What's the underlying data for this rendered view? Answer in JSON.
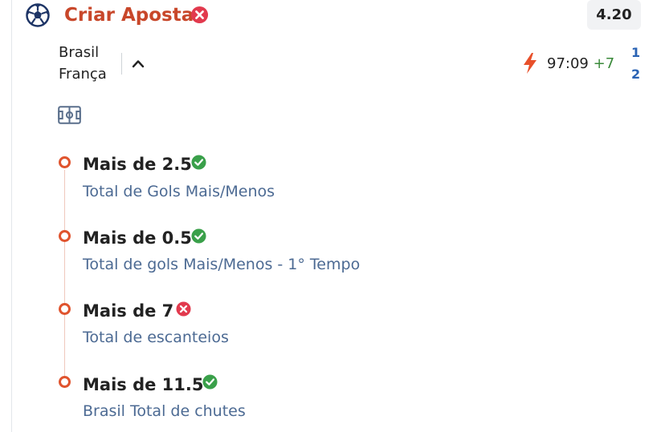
{
  "header": {
    "title": "Criar Aposta",
    "status_icon": "close-circle-icon",
    "odds": "4.20",
    "brand_icon": "soccer-ball-icon"
  },
  "match": {
    "home_team": "Brasil",
    "away_team": "França",
    "time": "97:09",
    "added_time": "+7",
    "home_score": "1",
    "away_score": "2",
    "live_icon": "lightning-bolt-icon",
    "field_icon": "soccer-field-icon"
  },
  "selections": [
    {
      "title": "Mais de 2.5",
      "market": "Total de Gols Mais/Menos",
      "result": "won",
      "result_icon": "check-circle-icon"
    },
    {
      "title": "Mais de 0.5",
      "market": "Total de gols Mais/Menos - 1° Tempo",
      "result": "won",
      "result_icon": "check-circle-icon"
    },
    {
      "title": "Mais de 7",
      "market": "Total de escanteios",
      "result": "lost",
      "result_icon": "close-circle-icon"
    },
    {
      "title": "Mais de 11.5",
      "market": "Brasil Total de chutes",
      "result": "won",
      "result_icon": "check-circle-icon"
    }
  ],
  "colors": {
    "title": "#c8472a",
    "lost": "#e23a4e",
    "won": "#3aa04a",
    "score": "#2a63b4",
    "market_text": "#4c6a93",
    "bolt": "#e8502a"
  }
}
